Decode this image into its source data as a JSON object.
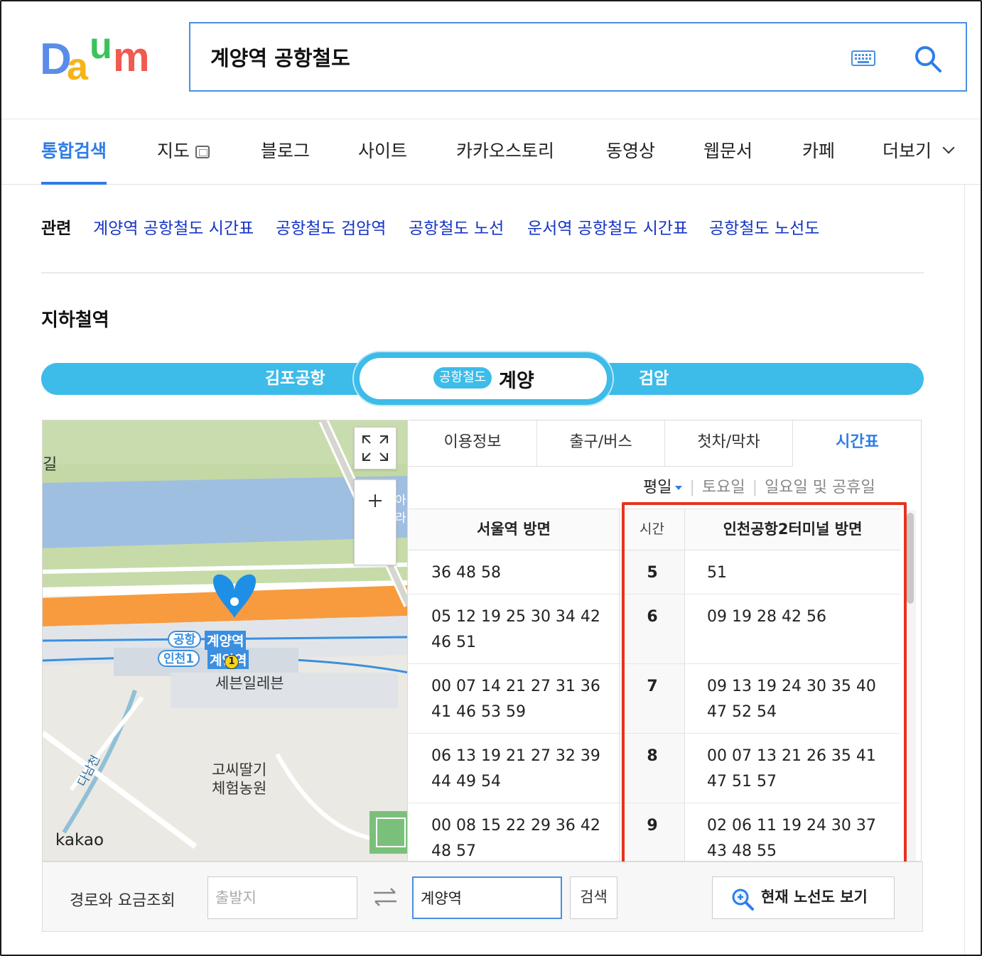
{
  "header": {
    "logo_text": "Daum",
    "search_value": "계양역 공항철도"
  },
  "tabs": [
    {
      "label": "통합검색"
    },
    {
      "label": "지도"
    },
    {
      "label": "블로그"
    },
    {
      "label": "사이트"
    },
    {
      "label": "카카오스토리"
    },
    {
      "label": "동영상"
    },
    {
      "label": "웹문서"
    },
    {
      "label": "카페"
    },
    {
      "label": "더보기"
    }
  ],
  "related": {
    "label": "관련",
    "links": [
      "계양역 공항철도 시간표",
      "공항철도 검암역",
      "공항철도 노선",
      "운서역 공항철도 시간표",
      "공항철도 노선도"
    ]
  },
  "section_title": "지하철역",
  "station": {
    "prev": "김포공항",
    "line_badge": "공항철도",
    "current": "계양",
    "next": "검암"
  },
  "map": {
    "labels": {
      "gil": "길",
      "line1": "공항",
      "line2": "인천1",
      "station1": "계양역",
      "station2": "계양역",
      "store": "세븐일레븐",
      "farm1": "고씨딸기",
      "farm2": "체험농원",
      "stream": "다남천",
      "exit": "1",
      "partial": "아라"
    },
    "attribution": "kakao"
  },
  "timetable": {
    "tabs": [
      "이용정보",
      "출구/버스",
      "첫차/막차",
      "시간표"
    ],
    "days": {
      "weekday": "평일",
      "saturday": "토요일",
      "sunday": "일요일 및 공휴일"
    },
    "headers": {
      "left": "서울역 방면",
      "hour": "시간",
      "right": "인천공항2터미널 방면"
    },
    "rows": [
      {
        "hour": "5",
        "left": "36 48 58",
        "right": "51"
      },
      {
        "hour": "6",
        "left": "05 12 19 25 30 34 42 46 51",
        "right": "09 19 28 42 56"
      },
      {
        "hour": "7",
        "left": "00 07 14 21 27 31 36 41 46 53 59",
        "right": "09 13 19 24 30 35 40 47 52 54"
      },
      {
        "hour": "8",
        "left": "06 13 19 21 27 32 39 44 49 54",
        "right": "00 07 13 21 26 35 41 47 51 57"
      },
      {
        "hour": "9",
        "left": "00 08 15 22 29 36 42 48 57",
        "right": "02 06 11 19 24 30 37 43 48 55"
      }
    ]
  },
  "route": {
    "label": "경로와 요금조회",
    "origin_placeholder": "출발지",
    "destination_value": "계양역",
    "search_label": "검색",
    "map_button": "현재 노선도 보기"
  },
  "colors": {
    "accent": "#2f7de6",
    "line_bar": "#3dbbe9",
    "highlight_box": "#e8321e",
    "link": "#1533c4"
  }
}
